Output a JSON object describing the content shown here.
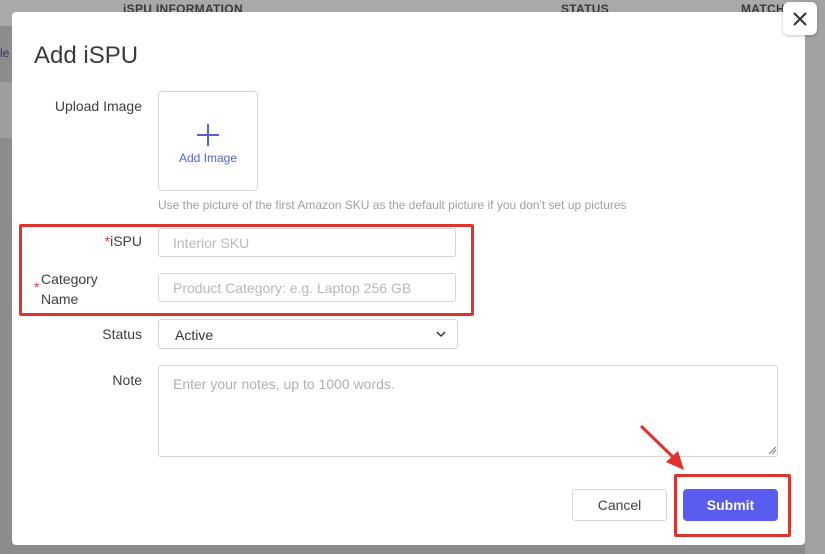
{
  "background": {
    "columns": [
      "iSPU INFORMATION",
      "STATUS",
      "MATCH"
    ],
    "side_fragment": "le"
  },
  "modal": {
    "title": "Add iSPU",
    "close_label": "✕",
    "upload": {
      "label": "Upload Image",
      "button_text": "Add Image",
      "hint": "Use the picture of the first Amazon SKU as the default picture if you don't set up pictures"
    },
    "fields": {
      "ispu": {
        "required_mark": "*",
        "label": "iSPU",
        "placeholder": "Interior SKU"
      },
      "category": {
        "required_mark": "*",
        "label": "Category Name",
        "label_line1": "Category",
        "label_line2": "Name",
        "placeholder": "Product Category: e.g. Laptop 256 GB"
      },
      "status": {
        "label": "Status",
        "value": "Active"
      },
      "note": {
        "label": "Note",
        "placeholder": "Enter your notes, up to 1000 words."
      }
    },
    "buttons": {
      "cancel": "Cancel",
      "submit": "Submit"
    }
  },
  "colors": {
    "accent": "#5a5cef",
    "required": "#e53a3a",
    "highlight": "#e0332b"
  }
}
